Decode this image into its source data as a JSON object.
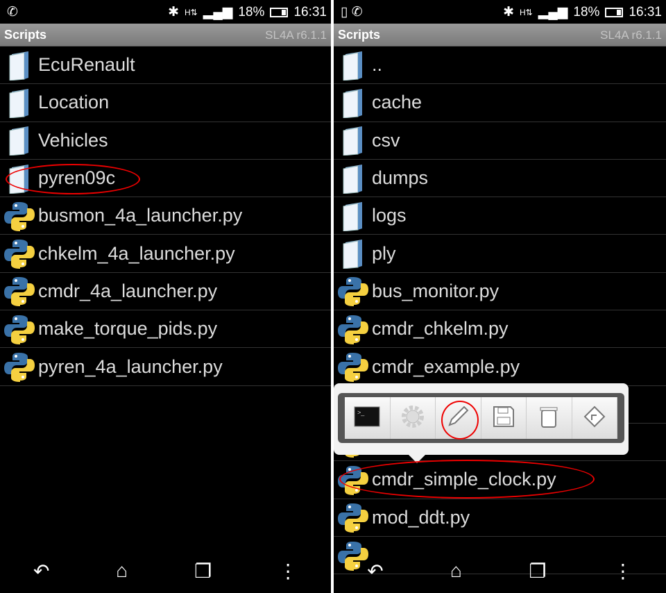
{
  "status": {
    "battery": "18%",
    "time": "16:31"
  },
  "left": {
    "title": "Scripts",
    "version": "SL4A r6.1.1",
    "items": [
      {
        "label": "EcuRenault",
        "type": "folder"
      },
      {
        "label": "Location",
        "type": "folder"
      },
      {
        "label": "Vehicles",
        "type": "folder"
      },
      {
        "label": "pyren09c",
        "type": "folder"
      },
      {
        "label": "busmon_4a_launcher.py",
        "type": "python"
      },
      {
        "label": "chkelm_4a_launcher.py",
        "type": "python"
      },
      {
        "label": "cmdr_4a_launcher.py",
        "type": "python"
      },
      {
        "label": "make_torque_pids.py",
        "type": "python"
      },
      {
        "label": "pyren_4a_launcher.py",
        "type": "python"
      }
    ]
  },
  "right": {
    "title": "Scripts",
    "version": "SL4A r6.1.1",
    "items": [
      {
        "label": "..",
        "type": "folder"
      },
      {
        "label": "cache",
        "type": "folder"
      },
      {
        "label": "csv",
        "type": "folder"
      },
      {
        "label": "dumps",
        "type": "folder"
      },
      {
        "label": "logs",
        "type": "folder"
      },
      {
        "label": "ply",
        "type": "folder"
      },
      {
        "label": "bus_monitor.py",
        "type": "python"
      },
      {
        "label": "cmdr_chkelm.py",
        "type": "python"
      },
      {
        "label": "cmdr_example.py",
        "type": "python"
      },
      {
        "label": "",
        "type": "python"
      },
      {
        "label": "",
        "type": "python"
      },
      {
        "label": "cmdr_simple_clock.py",
        "type": "python"
      },
      {
        "label": "mod_ddt.py",
        "type": "python"
      },
      {
        "label": "",
        "type": "python"
      }
    ],
    "popup_actions": [
      "terminal-icon",
      "gear-icon",
      "pencil-icon",
      "save-icon",
      "trash-icon",
      "shortcut-icon"
    ]
  },
  "colors": {
    "highlight": "#e00000",
    "python_blue": "#3a72a8",
    "python_yellow": "#f5d040"
  }
}
